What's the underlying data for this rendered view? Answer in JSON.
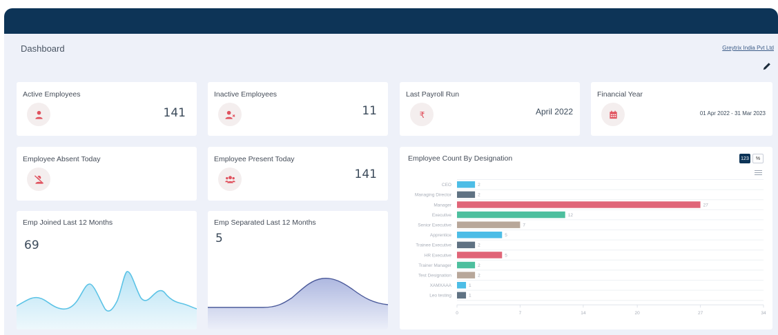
{
  "header": {
    "page_title": "Dashboard",
    "company_link": "Greytrix India Pvt Ltd",
    "edit_icon": "pencil-icon"
  },
  "cards": {
    "active_employees": {
      "label": "Active Employees",
      "value": "141",
      "icon": "user-icon",
      "icon_color": "#e0525e"
    },
    "inactive_employees": {
      "label": "Inactive Employees",
      "value": "11",
      "icon": "user-x-icon",
      "icon_color": "#e0525e"
    },
    "last_payroll_run": {
      "label": "Last Payroll Run",
      "value": "April 2022",
      "icon": "rupee-icon",
      "icon_color": "#e0525e"
    },
    "financial_year": {
      "label": "Financial Year",
      "value": "01 Apr 2022 - 31 Mar 2023",
      "icon": "calendar-icon",
      "icon_color": "#e0525e"
    },
    "employee_absent_today": {
      "label": "Employee Absent Today",
      "value": "",
      "icon": "user-slash-icon",
      "icon_color": "#e0525e"
    },
    "employee_present_today": {
      "label": "Employee Present Today",
      "value": "141",
      "icon": "users-icon",
      "icon_color": "#e0525e"
    }
  },
  "sparklines": {
    "joined": {
      "label": "Emp Joined Last 12 Months",
      "value": "69",
      "line_color": "#5cc3e6",
      "fill_color": "#d2edf8"
    },
    "separated": {
      "label": "Emp Separated Last 12 Months",
      "value": "5",
      "line_color": "#4b5a9a",
      "fill_color": "#c9d0ea"
    }
  },
  "designation_chart": {
    "title": "Employee Count By Designation",
    "toggle_count_label": "123",
    "toggle_percent_label": "%",
    "menu_icon": "hamburger-menu-icon"
  },
  "chart_data": {
    "type": "bar",
    "orientation": "horizontal",
    "title": "Employee Count By Designation",
    "categories": [
      "CEO",
      "Managing Director",
      "Manager",
      "Executive",
      "Senior Executive",
      "Apprentice",
      "Trainee Executive",
      "HR Executive",
      "Trainer Manager",
      "Test Designation",
      "XAMXAAA",
      "Leo testing"
    ],
    "values": [
      2,
      2,
      27,
      12,
      7,
      5,
      2,
      5,
      2,
      2,
      1,
      1
    ],
    "bar_colors": [
      "#4dbde6",
      "#5f7283",
      "#e06578",
      "#4dbf9e",
      "#b8a79a",
      "#4dbde6",
      "#5f7283",
      "#e06578",
      "#4dbf9e",
      "#b8a79a",
      "#4dbde6",
      "#5f7283"
    ],
    "x_ticks": [
      "0",
      "7",
      "14",
      "20",
      "27",
      "34"
    ],
    "xlim": [
      0,
      34
    ],
    "grid": true
  }
}
